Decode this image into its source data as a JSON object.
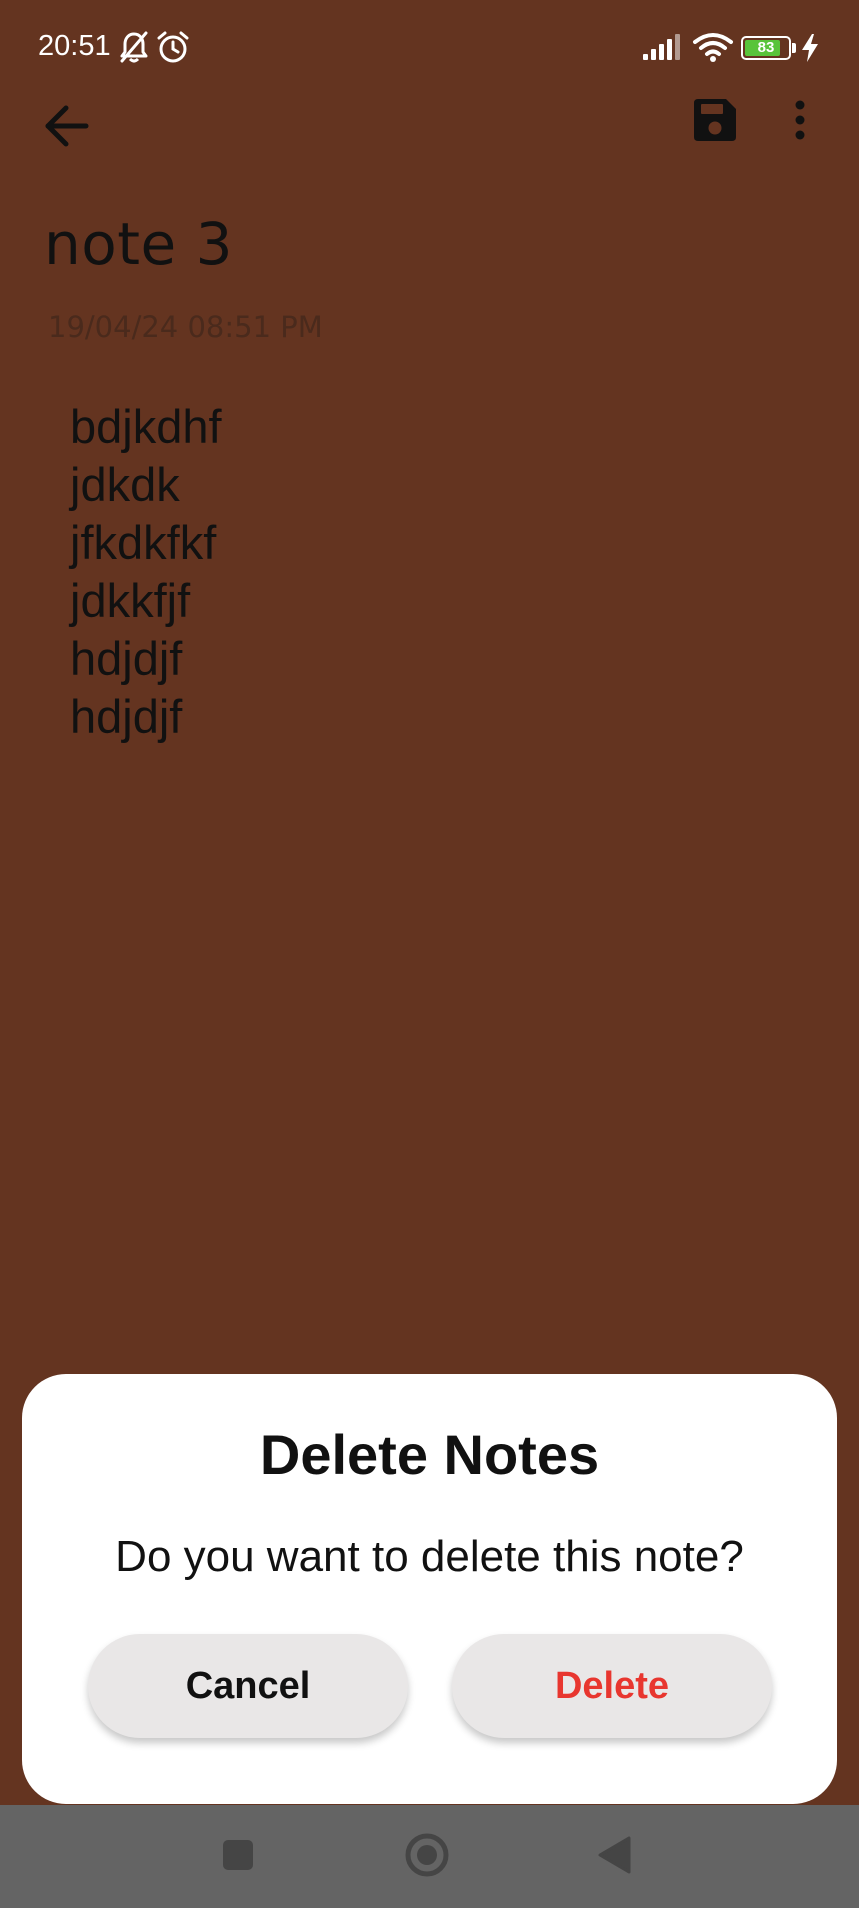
{
  "status_bar": {
    "time": "20:51",
    "battery_percent": "83",
    "battery_level": 0.83,
    "battery_color": "#58c43a",
    "icons": [
      "bell-muted-icon",
      "alarm-clock-icon",
      "signal-icon",
      "wifi-icon",
      "battery-icon",
      "charging-bolt-icon"
    ]
  },
  "toolbar": {
    "icons": [
      "back-arrow-icon",
      "save-icon",
      "more-vertical-icon"
    ]
  },
  "note": {
    "title": "note 3",
    "date": "19/04/24 08:51 PM",
    "body": "bdjkdhf\njdkdk\njfkdkfkf\njdkkfjf\nhdjdjf\nhdjdjf",
    "background_color": "#643420"
  },
  "dialog": {
    "title": "Delete Notes",
    "message": "Do you want to delete this note?",
    "cancel_label": "Cancel",
    "delete_label": "Delete",
    "delete_color": "#e8362f"
  },
  "nav_bar": {
    "icons": [
      "recents-square-icon",
      "home-circle-icon",
      "back-triangle-icon"
    ]
  }
}
